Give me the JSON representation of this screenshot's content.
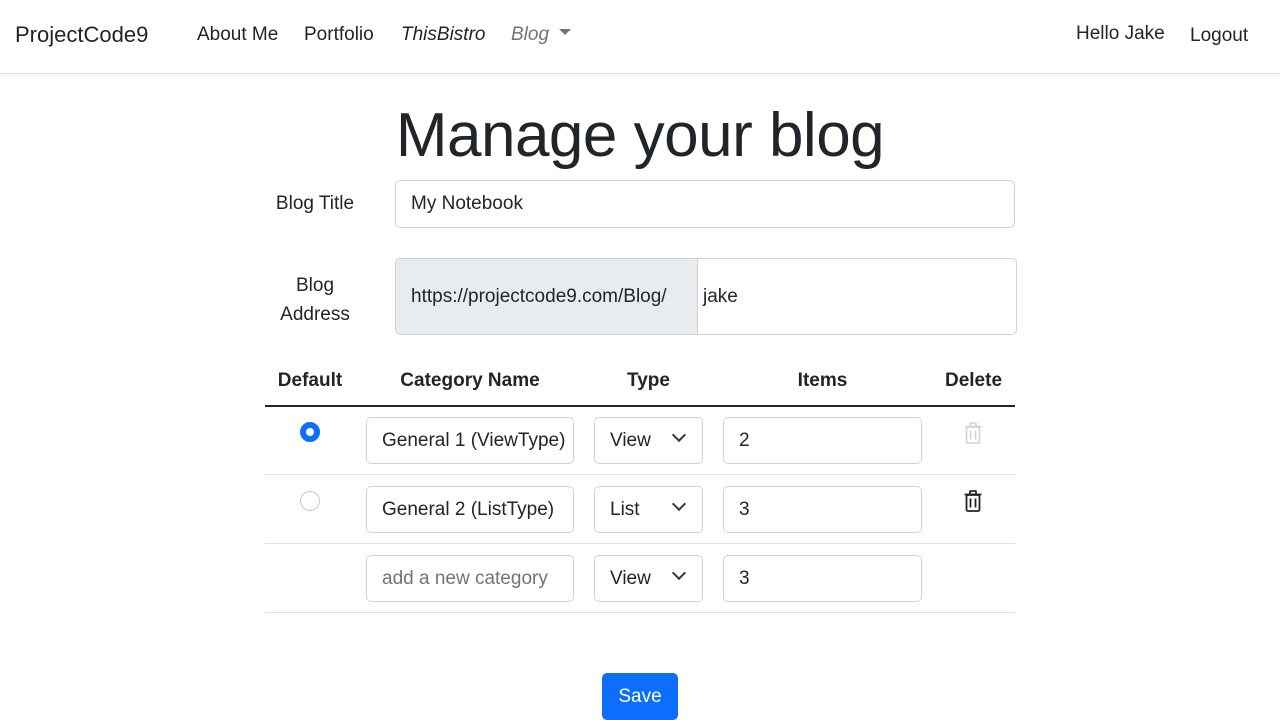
{
  "navbar": {
    "brand": "ProjectCode9",
    "links": [
      "About Me",
      "Portfolio",
      "ThisBistro",
      "Blog"
    ],
    "greeting": "Hello Jake",
    "logout": "Logout"
  },
  "page": {
    "title": "Manage your blog"
  },
  "form": {
    "blog_title_label": "Blog Title",
    "blog_title_value": "My Notebook",
    "blog_address_label_line1": "Blog",
    "blog_address_label_line2": "Address",
    "blog_address_prefix": "https://projectcode9.com/Blog/",
    "blog_address_value": "jake"
  },
  "table": {
    "headers": [
      "Default",
      "Category Name",
      "Type",
      "Items",
      "Delete"
    ],
    "rows": [
      {
        "default": true,
        "name": "General 1 (ViewType)",
        "type": "View",
        "items": "2",
        "delete_enabled": false
      },
      {
        "default": false,
        "name": "General 2 (ListType)",
        "type": "List",
        "items": "3",
        "delete_enabled": true
      }
    ],
    "new_row": {
      "placeholder": "add a new category",
      "type": "View",
      "items": "3"
    }
  },
  "actions": {
    "save": "Save"
  },
  "colors": {
    "primary": "#0d6efd",
    "muted": "#6c757d",
    "border": "#ced4da",
    "addon_bg": "#e9ecef"
  }
}
